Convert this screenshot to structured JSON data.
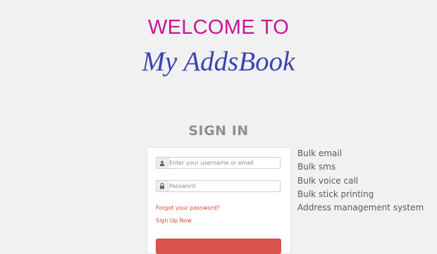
{
  "header": {
    "welcome": "WELCOME TO",
    "brand": "My AddsBook"
  },
  "signin": {
    "title": "SIGN IN",
    "username": {
      "icon": "user-icon",
      "placeholder": "Enter your username or email",
      "value": ""
    },
    "password": {
      "icon": "lock-icon",
      "placeholder": "Password",
      "value": ""
    },
    "forgot_link": "Forgot your password?",
    "signup_link": "Sign Up Now",
    "submit_color": "#d9534f"
  },
  "features": [
    "Bulk email",
    "Bulk sms",
    "Bulk voice call",
    "Bulk stick printing",
    "Address management system"
  ],
  "colors": {
    "welcome": "#c8159b",
    "brand": "#3f43b5",
    "link": "#d9452c",
    "background": "#f1f1f1"
  }
}
